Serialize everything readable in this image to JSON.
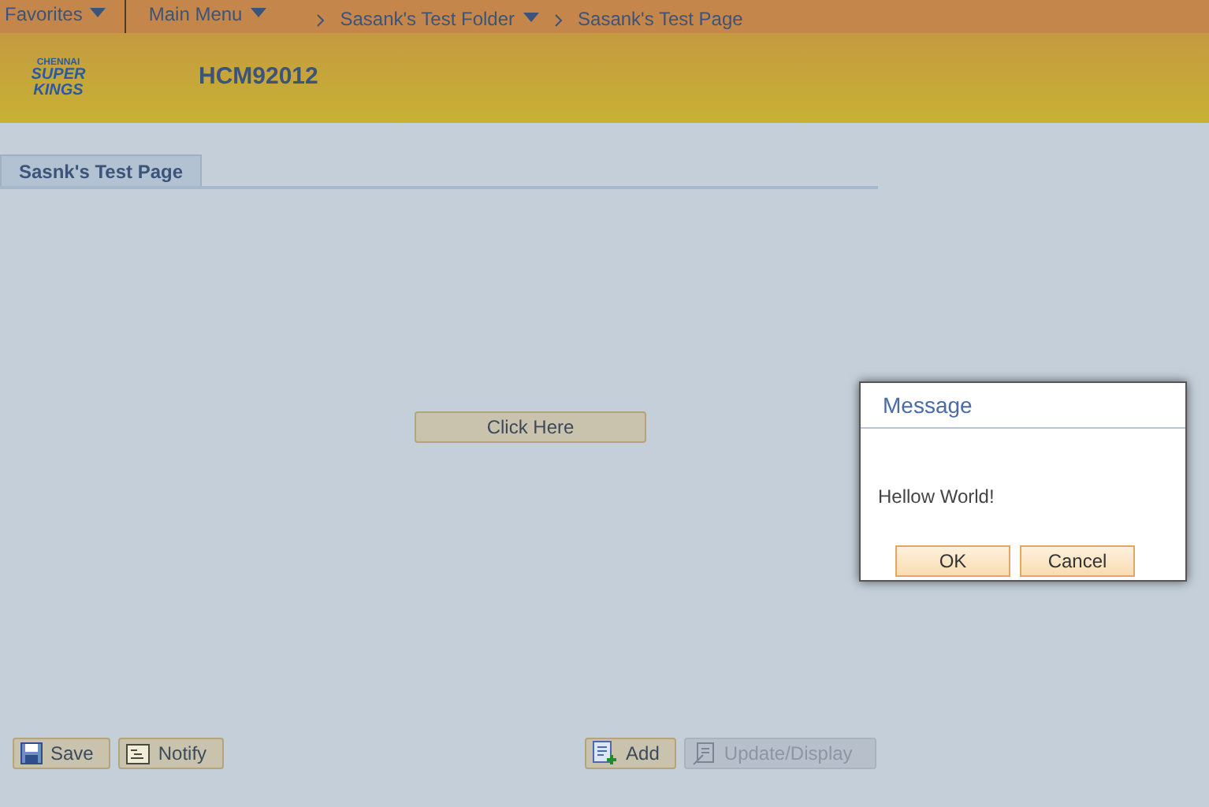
{
  "nav": [
    {
      "kind": "menu",
      "label": "Favorites",
      "dropdown": true
    },
    {
      "kind": "menu",
      "label": "Main Menu",
      "dropdown": true
    },
    {
      "kind": "crumb",
      "label": "Sasank's Test Folder",
      "dropdown": true
    },
    {
      "kind": "crumb",
      "label": "Sasank's Test Page",
      "dropdown": false
    }
  ],
  "logo": {
    "lines": [
      "CHENNAI",
      "SUPER",
      "KINGS"
    ]
  },
  "header": {
    "title": "HCM92012"
  },
  "tabs": [
    {
      "label": "Sasnk's Test Page",
      "selected": true
    }
  ],
  "page": {
    "button": "Click Here"
  },
  "toolbar_left": [
    {
      "kind": "save",
      "label": "Save",
      "disabled": false
    },
    {
      "kind": "notify",
      "label": "Notify",
      "disabled": false
    }
  ],
  "toolbar_right": [
    {
      "kind": "add",
      "label": "Add",
      "disabled": false
    },
    {
      "kind": "update",
      "label": "Update/Display",
      "disabled": true
    }
  ],
  "dialog": {
    "title": "Message",
    "message": "Hellow World!",
    "buttons": [
      "OK",
      "Cancel"
    ]
  }
}
